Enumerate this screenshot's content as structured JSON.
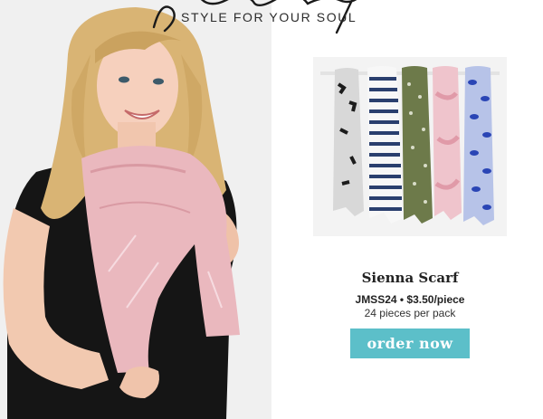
{
  "header": {
    "tagline": "STYLE FOR YOUR SOUL"
  },
  "hero": {
    "image_label": "woman-wearing-pink-scarf"
  },
  "product": {
    "image_label": "five-printed-scarves-on-rack",
    "name": "Sienna Scarf",
    "sku_price": "JMSS24 • $3.50/piece",
    "pack_info": "24 pieces per pack",
    "cta_label": "order now"
  },
  "colors": {
    "cta_background": "#5cbfc9",
    "scarf_pink": "#eab8be",
    "shirt_black": "#141414",
    "hair_blonde": "#d9b474"
  }
}
